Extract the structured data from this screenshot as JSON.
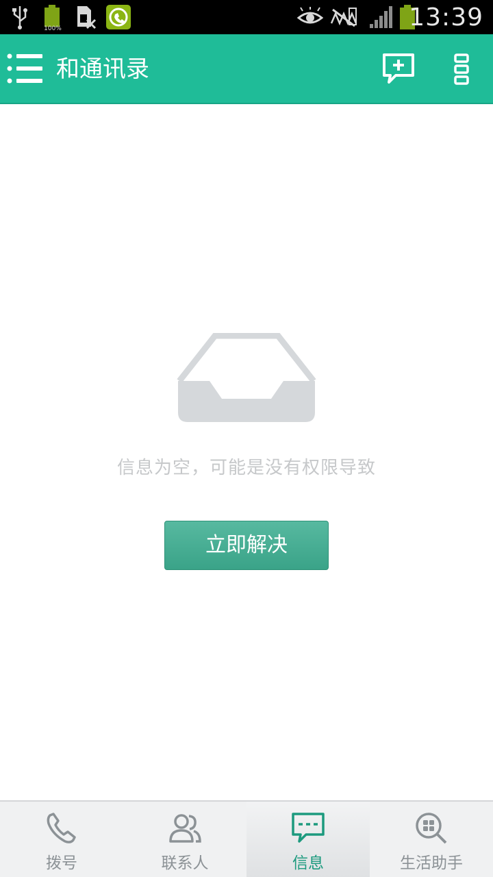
{
  "status_bar": {
    "time": "13:39",
    "battery_small_label": "100%",
    "icons": [
      "usb-icon",
      "battery-icon",
      "sim-icon",
      "app-notification-icon",
      "eye-icon",
      "no-signal-icon",
      "signal-bars-icon",
      "battery-icon"
    ]
  },
  "app_bar": {
    "title": "和通讯录",
    "background": "#1fbc98",
    "icons": [
      "menu-icon",
      "new-message-icon",
      "more-icon"
    ]
  },
  "empty_state": {
    "icon": "empty-inbox-icon",
    "message": "信息为空，可能是没有权限导致",
    "button_label": "立即解决",
    "button_color": "#3aa388"
  },
  "bottom_nav": {
    "active_color": "#1c9a7e",
    "tabs": [
      {
        "label": "拨号",
        "icon": "phone-icon",
        "active": false
      },
      {
        "label": "联系人",
        "icon": "contacts-icon",
        "active": false
      },
      {
        "label": "信息",
        "icon": "message-icon",
        "active": true
      },
      {
        "label": "生活助手",
        "icon": "life-assistant-icon",
        "active": false
      }
    ]
  }
}
